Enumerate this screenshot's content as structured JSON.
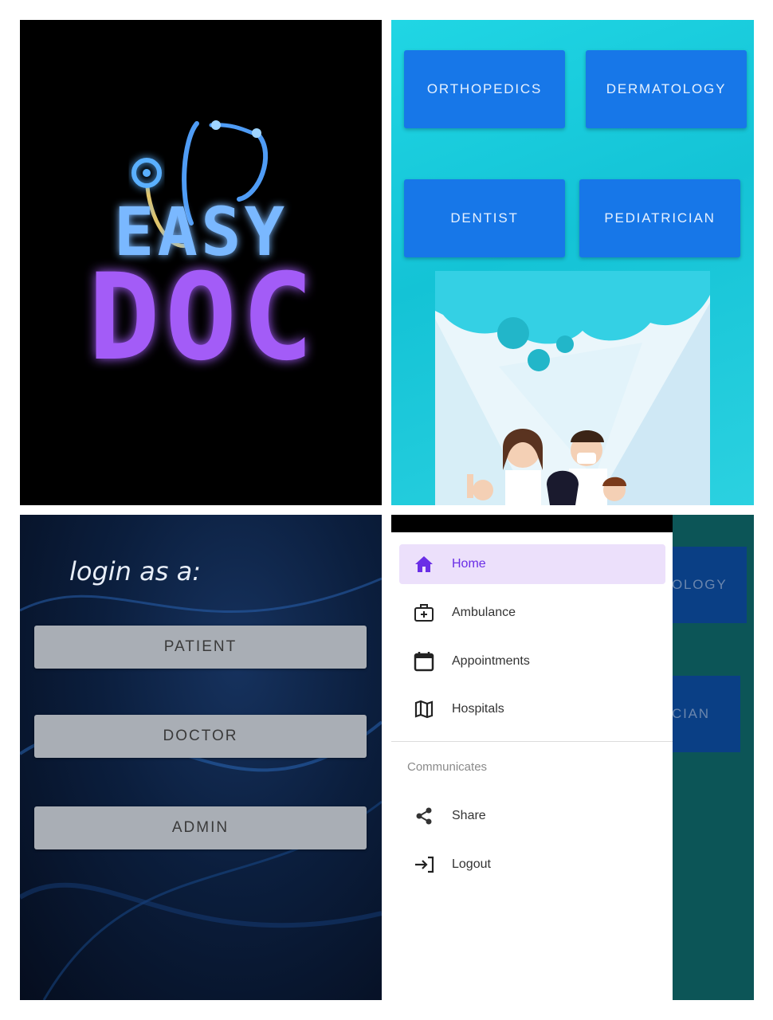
{
  "splash": {
    "logo_line1": "EASY",
    "logo_line2": "DOC",
    "colors": {
      "line1": "#7ab8ff",
      "line2": "#a35cf7",
      "stethoscope": "#5aa6ff"
    }
  },
  "specialties": {
    "buttons": [
      "ORTHOPEDICS",
      "DERMATOLOGY",
      "DENTIST",
      "PEDIATRICIAN"
    ],
    "button_color": "#1777e8"
  },
  "login": {
    "title": "login as a:",
    "roles": [
      "PATIENT",
      "DOCTOR",
      "ADMIN"
    ]
  },
  "drawer": {
    "items": [
      {
        "label": "Home",
        "icon": "home-icon",
        "active": true
      },
      {
        "label": "Ambulance",
        "icon": "medical-bag-icon",
        "active": false
      },
      {
        "label": "Appointments",
        "icon": "calendar-icon",
        "active": false
      },
      {
        "label": "Hospitals",
        "icon": "map-icon",
        "active": false
      }
    ],
    "section_title": "Communicates",
    "section_items": [
      {
        "label": "Share",
        "icon": "share-icon"
      },
      {
        "label": "Logout",
        "icon": "logout-icon"
      }
    ],
    "accent": "#6a2ee6",
    "background_partial_labels": [
      "OLOGY",
      "CIAN"
    ]
  }
}
